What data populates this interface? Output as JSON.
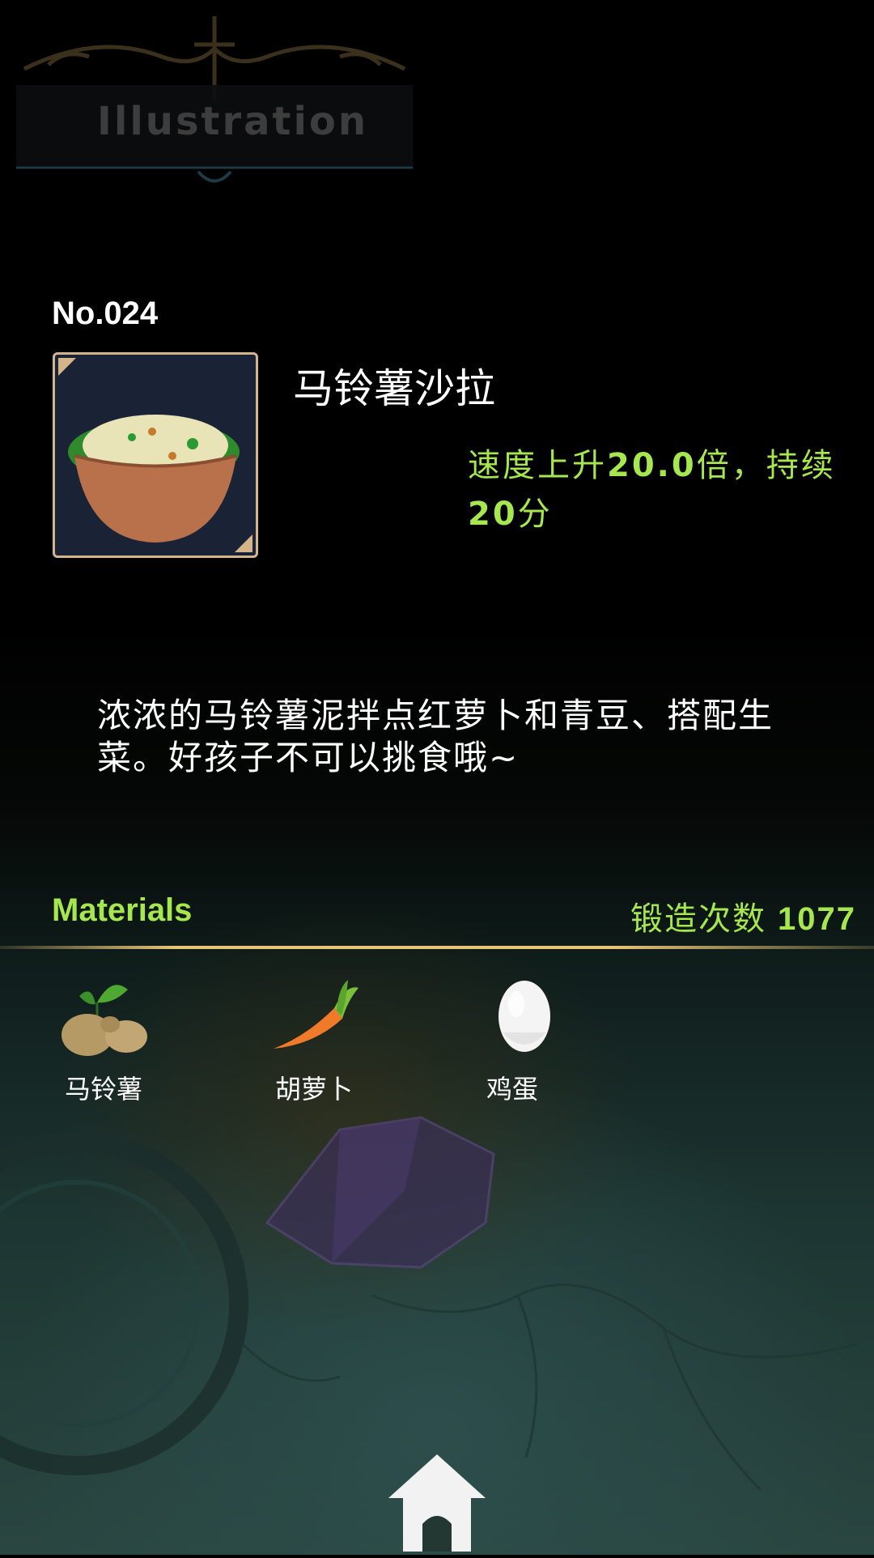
{
  "header": {
    "title": "Illustration"
  },
  "item": {
    "number": "No.024",
    "name": "马铃薯沙拉",
    "effect": {
      "prefix": "速度上升",
      "multiplier": "20.0",
      "mid": "倍，持续 ",
      "duration": "20",
      "suffix": "分"
    },
    "image_icon": "potato-salad-icon",
    "description": "浓浓的马铃薯泥拌点红萝卜和青豆、搭配生菜。好孩子不可以挑食哦~"
  },
  "materials": {
    "label": "Materials",
    "forge_label": "锻造次数",
    "forge_count": "1077",
    "items": [
      {
        "label": "马铃薯",
        "icon": "potato-icon"
      },
      {
        "label": "胡萝卜",
        "icon": "carrot-icon"
      },
      {
        "label": "鸡蛋",
        "icon": "egg-icon"
      }
    ]
  },
  "footer": {
    "home_icon": "home-icon"
  },
  "colors": {
    "accent_green": "#a6e64f",
    "frame_gold": "#d4b489",
    "divider_gold": "#e8c478"
  }
}
